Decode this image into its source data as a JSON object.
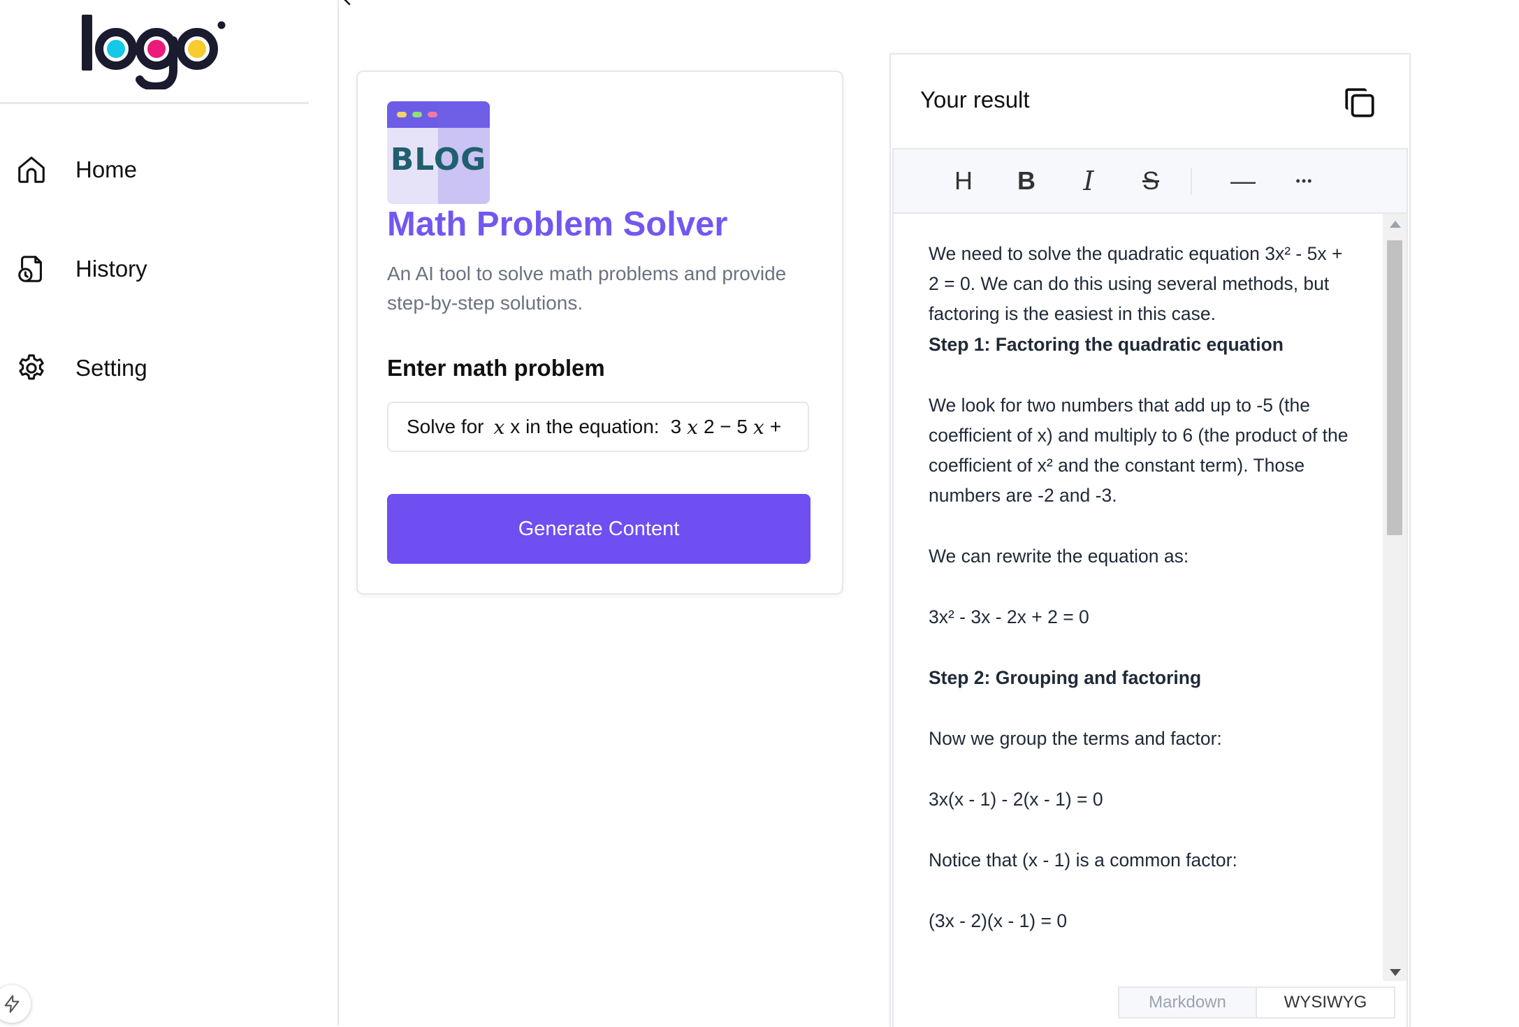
{
  "sidebar": {
    "logo_text": "logo",
    "nav": [
      {
        "label": "Home",
        "icon": "home-icon"
      },
      {
        "label": "History",
        "icon": "history-icon"
      },
      {
        "label": "Setting",
        "icon": "gear-icon"
      }
    ]
  },
  "tool": {
    "icon_text": "BLOG",
    "title": "Math Problem Solver",
    "description": "An AI tool to solve math problems and provide step-by-step solutions.",
    "field_label": "Enter math problem",
    "input_value": {
      "prefix": "Solve for",
      "var": "x",
      "middle": "x in the equation:",
      "eq_a": "3",
      "eq_b": "2 − 5",
      "eq_c": "+"
    },
    "button_label": "Generate Content"
  },
  "result": {
    "title": "Your result",
    "toolbar": [
      "H",
      "B",
      "I",
      "S",
      "—",
      "•••"
    ],
    "paragraphs": [
      {
        "text": "We need to solve the quadratic equation 3x² - 5x + 2 = 0.  We can do this using several methods, but factoring is the easiest in this case.",
        "bold": false
      },
      {
        "text": "Step 1: Factoring the quadratic equation",
        "bold": true
      },
      {
        "text": "We look for two numbers that add up to -5 (the coefficient of x) and multiply to 6 (the product of the coefficient of x² and the constant term).  Those numbers are -2 and -3.",
        "bold": false
      },
      {
        "text": "We can rewrite the equation as:",
        "bold": false
      },
      {
        "text": "3x² - 3x - 2x + 2 = 0",
        "bold": false
      },
      {
        "text": "Step 2: Grouping and factoring",
        "bold": true
      },
      {
        "text": "Now we group the terms and factor:",
        "bold": false
      },
      {
        "text": "3x(x - 1) - 2(x - 1) = 0",
        "bold": false
      },
      {
        "text": "Notice that (x - 1) is a common factor:",
        "bold": false
      },
      {
        "text": "(3x - 2)(x - 1) = 0",
        "bold": false
      }
    ],
    "tabs": {
      "markdown": "Markdown",
      "wysiwyg": "WYSIWYG"
    }
  },
  "colors": {
    "accent": "#6f4ef2",
    "title": "#7357f0"
  }
}
